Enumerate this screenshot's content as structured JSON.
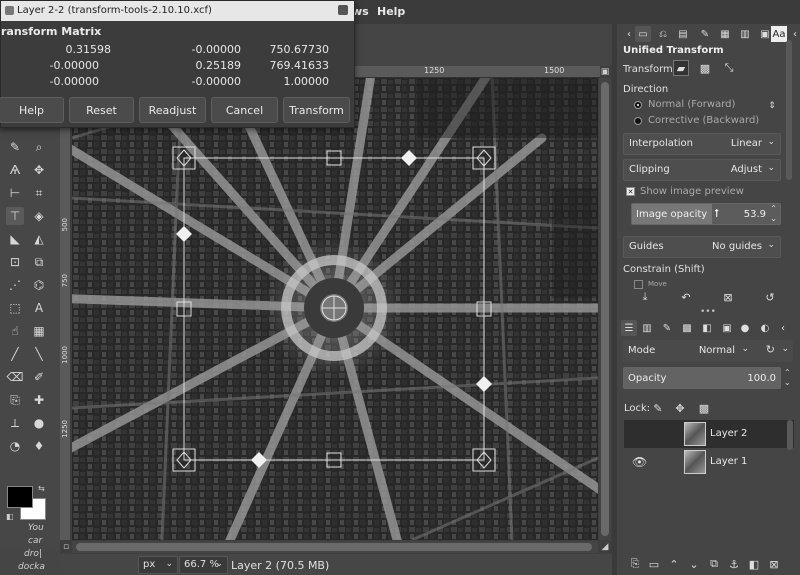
{
  "menubar": {
    "items": [
      "ws",
      "Help"
    ]
  },
  "dialog": {
    "title": "Layer 2-2 (transform-tools-2.10.10.xcf)",
    "heading": "ransform Matrix",
    "matrix": [
      [
        "0.31598",
        "-0.00000",
        "750.67730"
      ],
      [
        "-0.00000",
        "0.25189",
        "769.41633"
      ],
      [
        "-0.00000",
        "-0.00000",
        "1.00000"
      ]
    ],
    "buttons": {
      "help": "Help",
      "reset": "Reset",
      "readjust": "Readjust",
      "cancel": "Cancel",
      "transform": "Transform"
    }
  },
  "ruler": {
    "top_labels": [
      "1250",
      "1500"
    ],
    "left_labels": [
      "500",
      "750",
      "1000",
      "1250"
    ]
  },
  "toolbox": {
    "hint_lines": [
      "You",
      "car",
      "dro|",
      "docka"
    ]
  },
  "statusbar": {
    "unit": "px",
    "zoom": "66.7 %",
    "layer_info": "Layer 2 (70.5 MB)"
  },
  "tool_options": {
    "title": "Unified Transform",
    "transform_label": "Transform:",
    "direction_label": "Direction",
    "direction_normal": "Normal (Forward)",
    "direction_corrective": "Corrective (Backward)",
    "interpolation_label": "Interpolation",
    "interpolation_value": "Linear",
    "clipping_label": "Clipping",
    "clipping_value": "Adjust",
    "show_preview_label": "Show image preview",
    "image_opacity_label": "Image opacity",
    "image_opacity_value": "53.9",
    "image_opacity_fraction": 0.539,
    "guides_label": "Guides",
    "guides_value": "No guides",
    "constrain_label": "Constrain (Shift)",
    "move_label": "Move"
  },
  "layers": {
    "mode_label": "Mode",
    "mode_value": "Normal",
    "opacity_label": "Opacity",
    "opacity_value": "100.0",
    "lock_label": "Lock:",
    "items": [
      {
        "name": "Layer 2",
        "visible": false,
        "selected": true
      },
      {
        "name": "Layer 1",
        "visible": true,
        "selected": false
      }
    ]
  },
  "colors": {
    "foreground": "#000000",
    "background": "#ffffff",
    "accent": "#4e4e4e"
  }
}
